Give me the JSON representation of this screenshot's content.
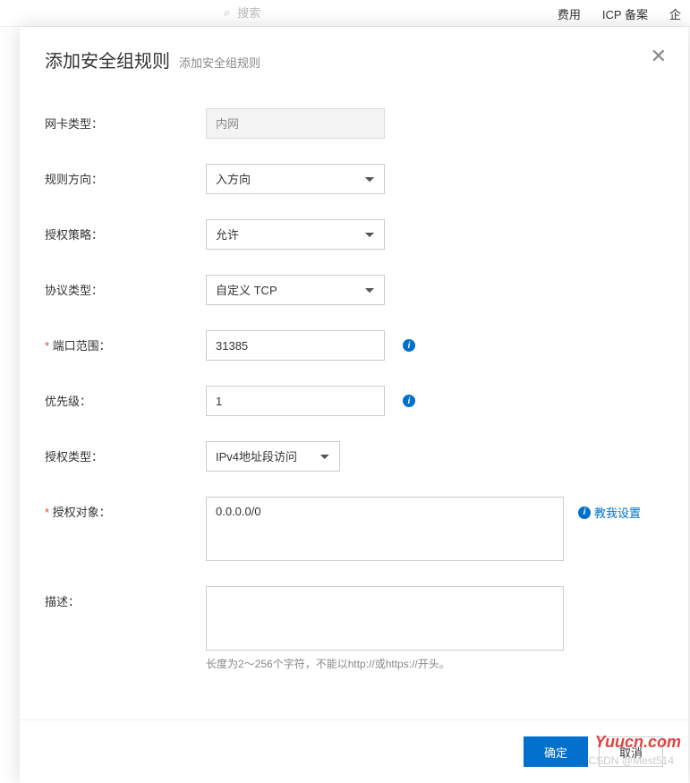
{
  "background": {
    "search_placeholder": "搜索",
    "nav": [
      "费用",
      "ICP 备案",
      "企"
    ]
  },
  "modal": {
    "title": "添加安全组规则",
    "subtitle": "添加安全组规则",
    "close_icon": "✕"
  },
  "form": {
    "nic_type": {
      "label": "网卡类型：",
      "value": "内网"
    },
    "direction": {
      "label": "规则方向：",
      "value": "入方向"
    },
    "policy": {
      "label": "授权策略：",
      "value": "允许"
    },
    "protocol": {
      "label": "协议类型：",
      "value": "自定义 TCP"
    },
    "port_range": {
      "label": "端口范围：",
      "value": "31385"
    },
    "priority": {
      "label": "优先级：",
      "value": "1"
    },
    "auth_type": {
      "label": "授权类型：",
      "value": "IPv4地址段访问"
    },
    "auth_object": {
      "label": "授权对象：",
      "value": "0.0.0.0/0",
      "help_link": "教我设置"
    },
    "description": {
      "label": "描述：",
      "value": "",
      "hint": "长度为2～256个字符，不能以http://或https://开头。"
    }
  },
  "footer": {
    "confirm": "确定",
    "cancel": "取消"
  },
  "watermark": {
    "main": "Yuucn.com",
    "sub": "CSDN @Mest514"
  }
}
